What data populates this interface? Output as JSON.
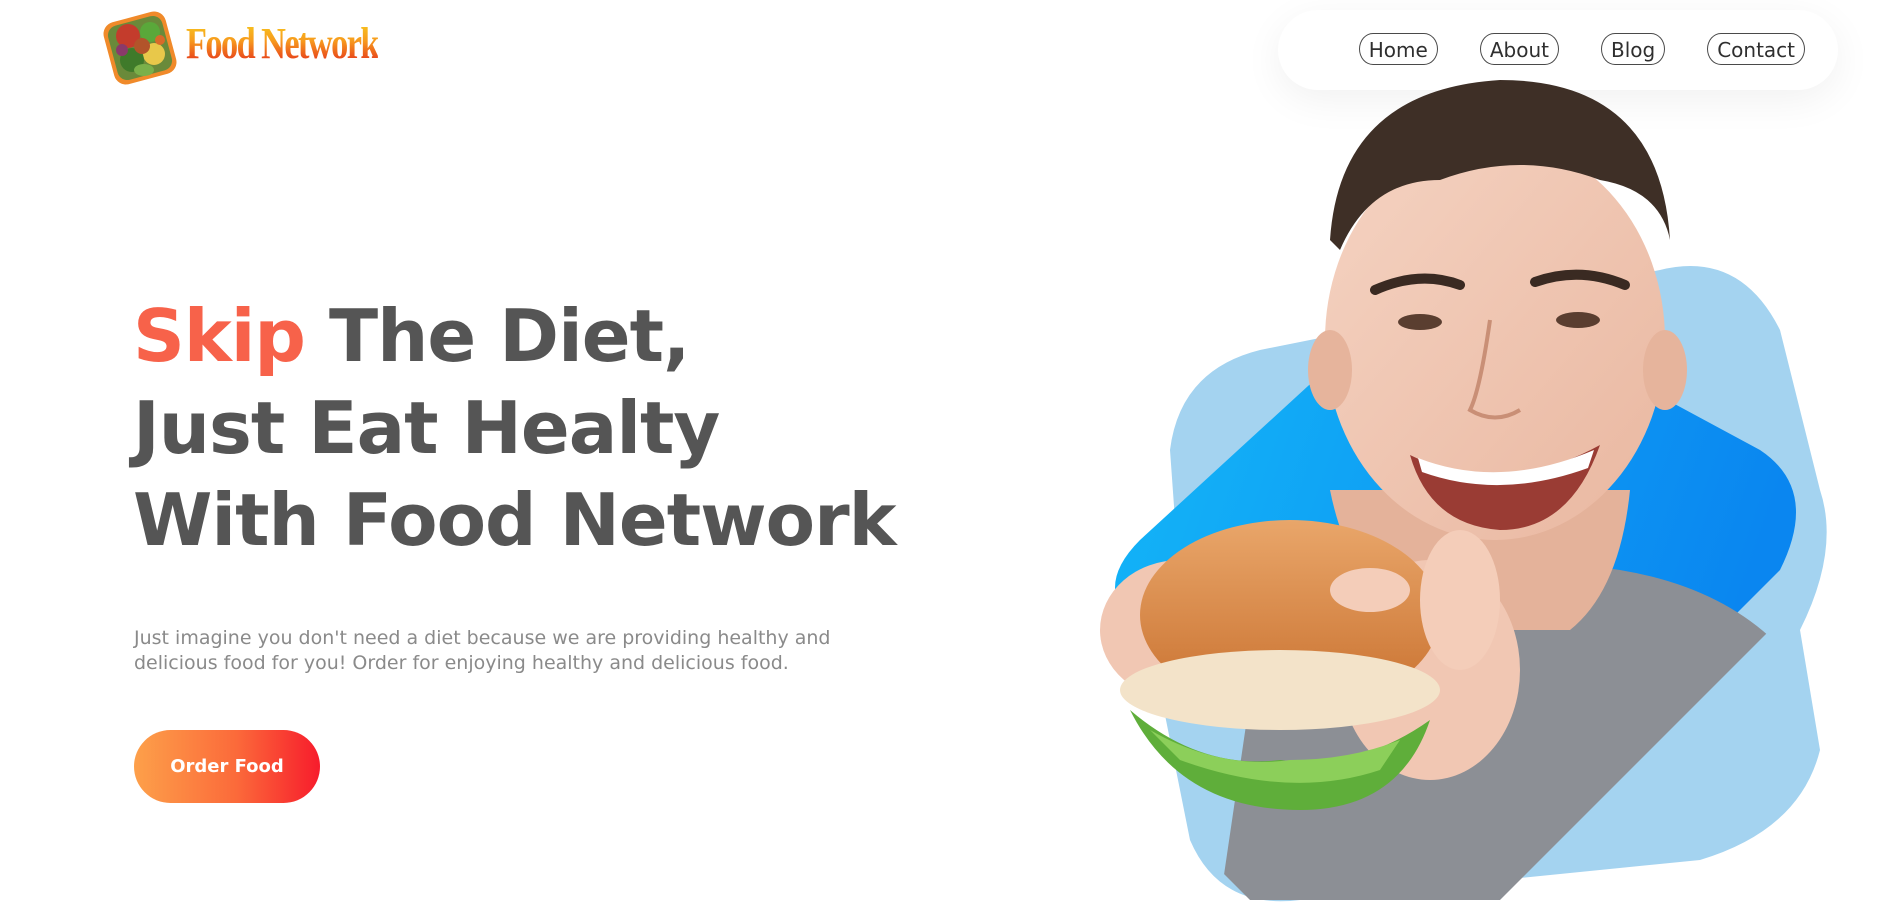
{
  "brand": {
    "name": "Food Network",
    "logo_icon": "vegetable-basket-icon"
  },
  "nav": {
    "items": [
      {
        "label": "Home"
      },
      {
        "label": "About"
      },
      {
        "label": "Blog"
      },
      {
        "label": "Contact"
      }
    ]
  },
  "hero": {
    "headline_accent": "Skip",
    "headline_line1_rest": " The Diet,",
    "headline_line2": "Just Eat Healty",
    "headline_line3": "With Food Network",
    "tagline": "Just imagine you don't need a diet because we are providing healthy and delicious food for you! Order for enjoying healthy and delicious food.",
    "cta_label": "Order Food",
    "image": "man-eating-burger-photo"
  },
  "colors": {
    "accent": "#f7624a",
    "heading": "#555555",
    "body_text": "#8a8a8a",
    "cta_gradient_start": "#fda04a",
    "cta_gradient_end": "#f71c2c",
    "shape_light_blue": "#a4d3f0",
    "shape_blue": "#1c9cf5"
  }
}
